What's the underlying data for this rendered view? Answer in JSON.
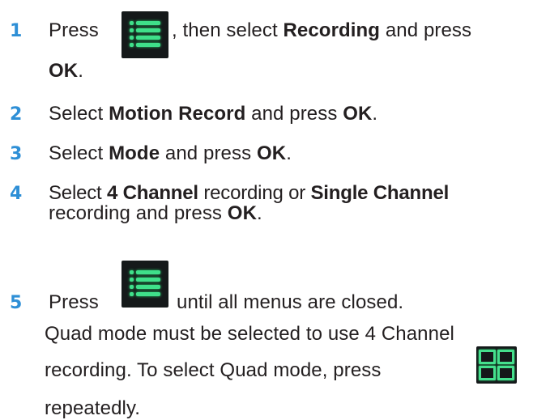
{
  "steps": [
    {
      "number": "1",
      "line1_pre": "Press",
      "line1_after_icon": ", then select ",
      "line1_bold": "Recording",
      "line1_post": " and press",
      "line2_bold": "OK",
      "line2_post": "."
    },
    {
      "number": "2",
      "pre": "Select ",
      "bold1": "Motion Record",
      "mid": " and press ",
      "bold2": "OK",
      "post": "."
    },
    {
      "number": "3",
      "pre": "Select ",
      "bold1": "Mode",
      "mid": " and press ",
      "bold2": "OK",
      "post": "."
    },
    {
      "number": "4",
      "line1_pre": "Select ",
      "line1_bold1": "4 Channel",
      "line1_mid": " recording or ",
      "line1_bold2": "Single Channel",
      "line2_pre": "recording and press ",
      "line2_bold": "OK",
      "line2_post": "."
    },
    {
      "number": "5",
      "pre": "Press",
      "post": "until all menus are closed."
    }
  ],
  "note": {
    "line1": "Quad mode must be selected to use 4 Channel",
    "line2_pre": "recording. To select Quad mode, press",
    "line3": "repeatedly."
  },
  "icons": {
    "menu": "menu-list-icon",
    "quad": "quad-view-icon",
    "menu_color": "#3fe08a",
    "quad_color": "#45e08d",
    "number_color": "#2e8fd6"
  }
}
